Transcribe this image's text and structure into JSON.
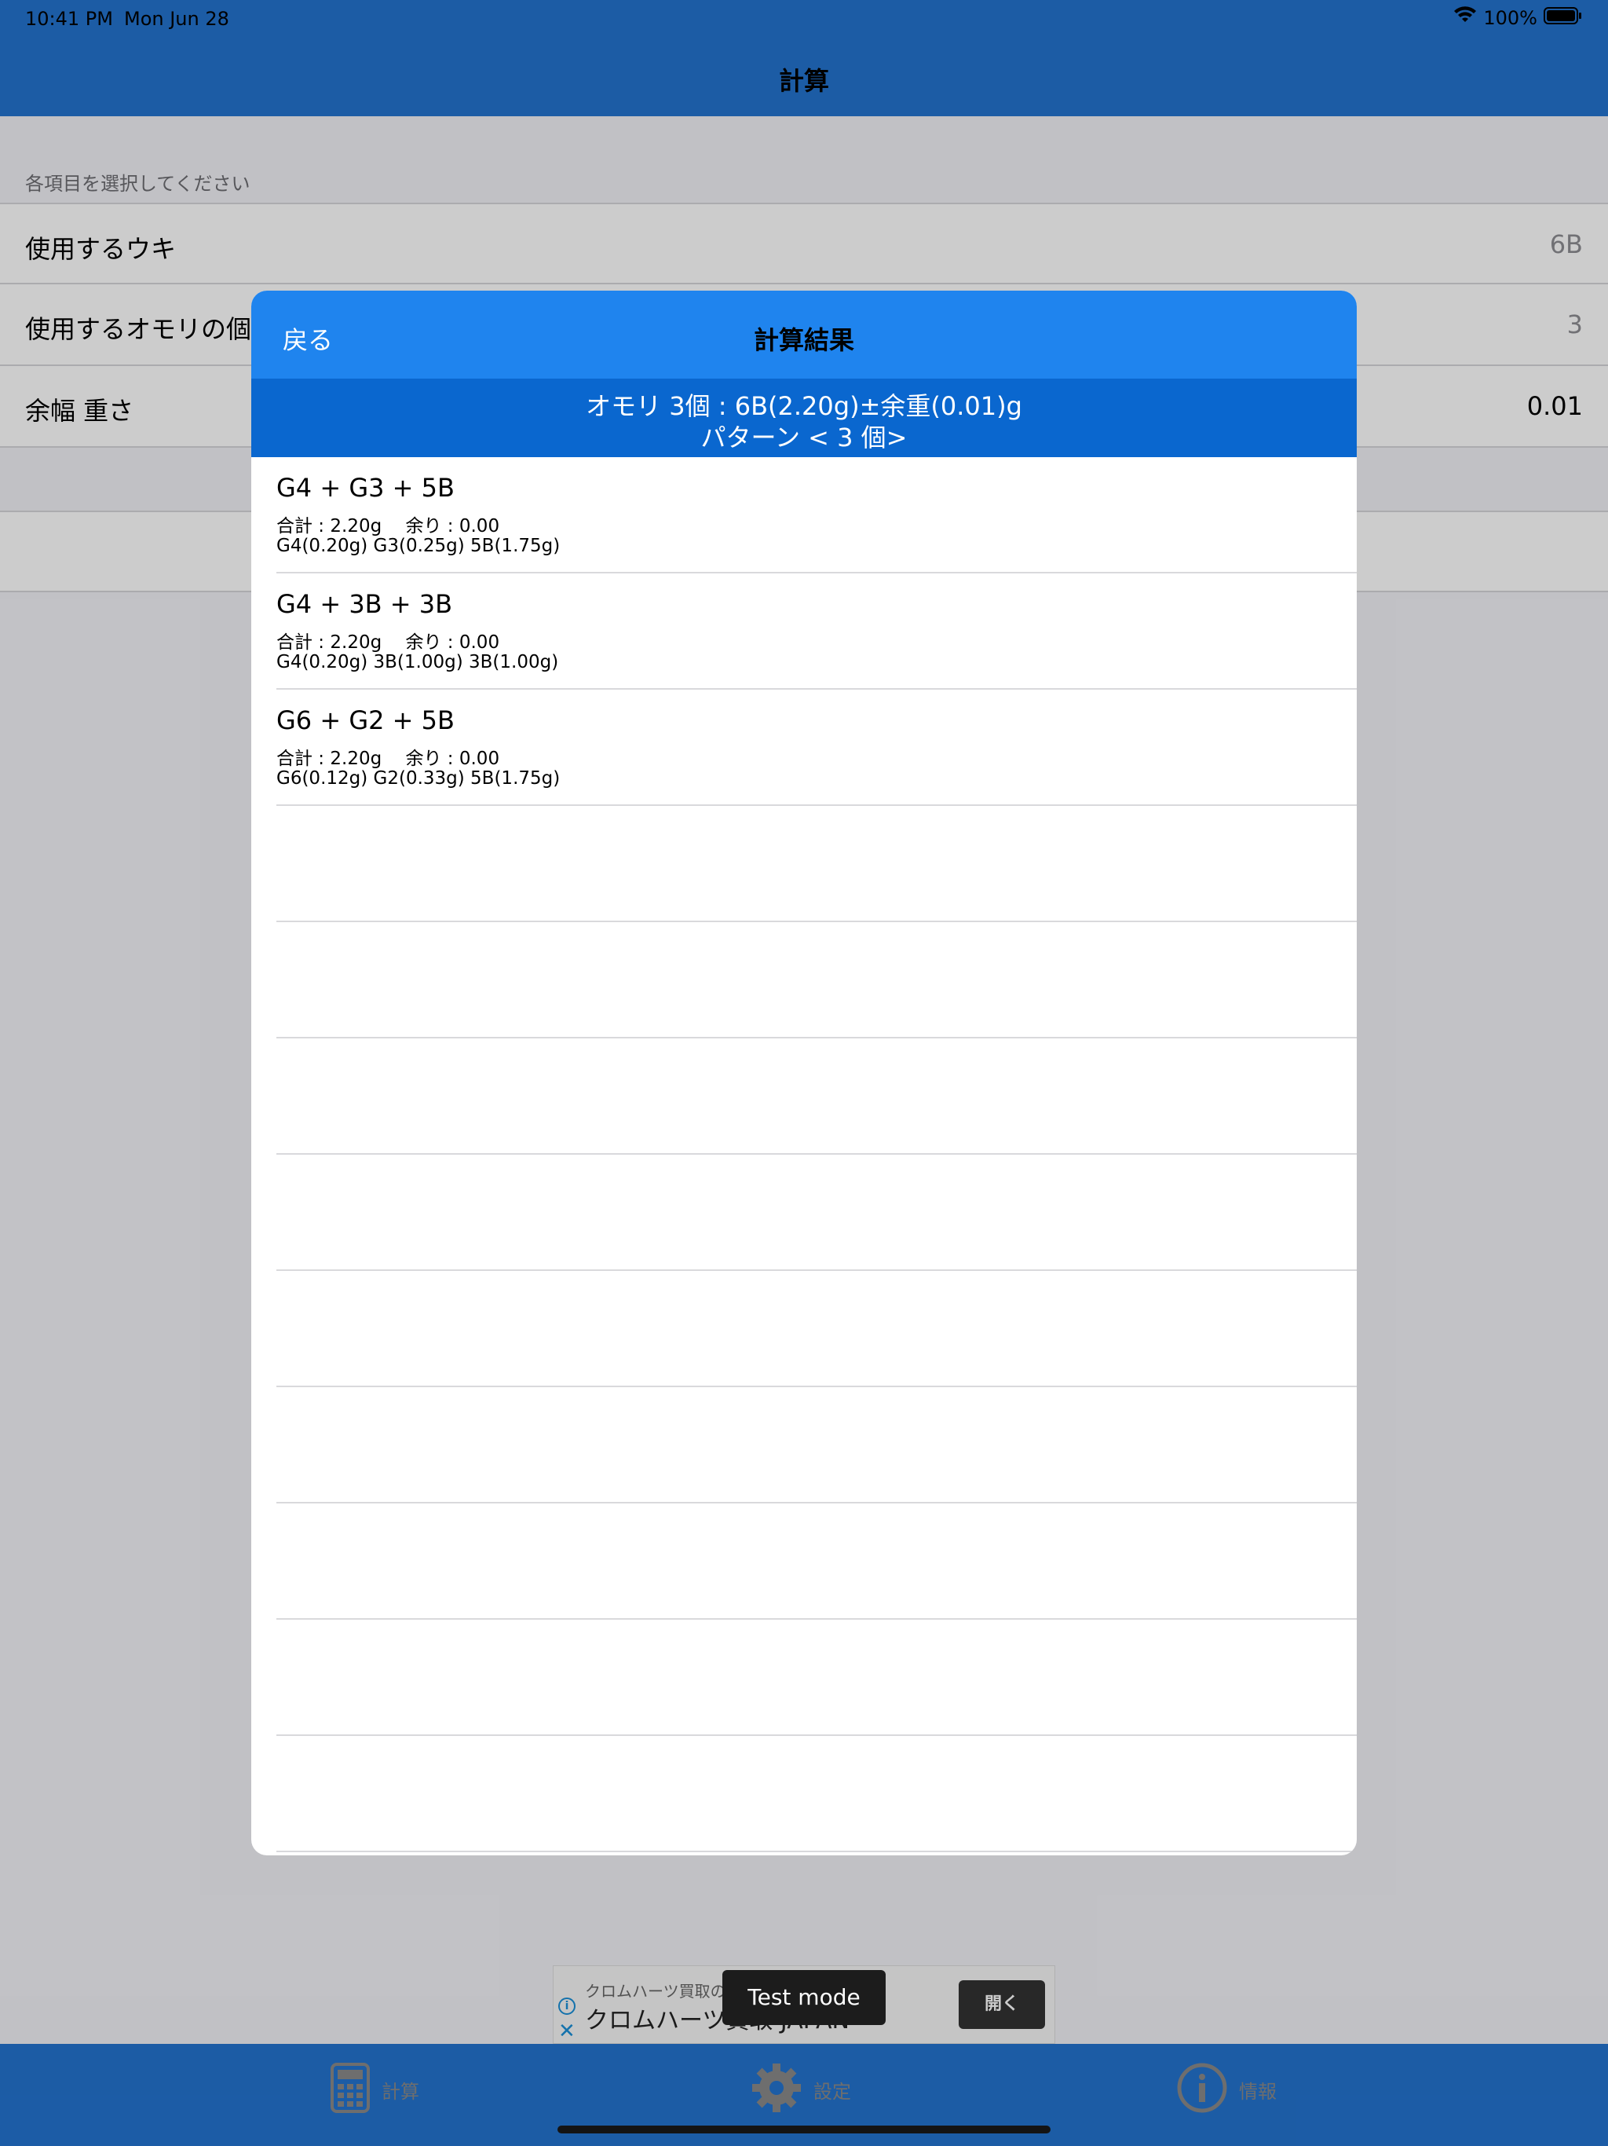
{
  "status_bar": {
    "time": "10:41 PM",
    "date": "Mon Jun 28",
    "battery_text": "100%",
    "wifi_icon": "wifi-icon",
    "battery_icon": "battery-icon"
  },
  "nav": {
    "title": "計算"
  },
  "form": {
    "section_header": "各項目を選択してください",
    "rows": [
      {
        "label": "使用するウキ",
        "value": "6B"
      },
      {
        "label": "使用するオモリの個数",
        "value": "3"
      },
      {
        "label": "余幅 重さ",
        "value": "0.01"
      }
    ]
  },
  "modal": {
    "back_label": "戻る",
    "title": "計算結果",
    "summary_line1": "オモリ 3個 : 6B(2.20g)±余重(0.01)g",
    "summary_line2": "パターン < 3 個>",
    "results": [
      {
        "combo": "G4 + G3 + 5B",
        "total": "合計 : 2.20g　 余り : 0.00",
        "detail": "G4(0.20g) G3(0.25g) 5B(1.75g)"
      },
      {
        "combo": "G4 + 3B + 3B",
        "total": "合計 : 2.20g　 余り : 0.00",
        "detail": "G4(0.20g) 3B(1.00g) 3B(1.00g)"
      },
      {
        "combo": "G6 + G2 + 5B",
        "total": "合計 : 2.20g　 余り : 0.00",
        "detail": "G6(0.12g) G2(0.33g) 5B(1.75g)"
      }
    ]
  },
  "ad": {
    "subtitle": "クロムハーツ買取の",
    "title": "クロムハーツ買取 JAPAN",
    "open_label": "開く",
    "test_mode_label": "Test mode"
  },
  "tabs": [
    {
      "label": "計算",
      "icon": "calculator-icon"
    },
    {
      "label": "設定",
      "icon": "gear-icon"
    },
    {
      "label": "情報",
      "icon": "info-icon"
    }
  ],
  "colors": {
    "nav_blue": "#2373cf",
    "modal_header_blue": "#1f84ee",
    "modal_summary_blue": "#0a67cf"
  }
}
